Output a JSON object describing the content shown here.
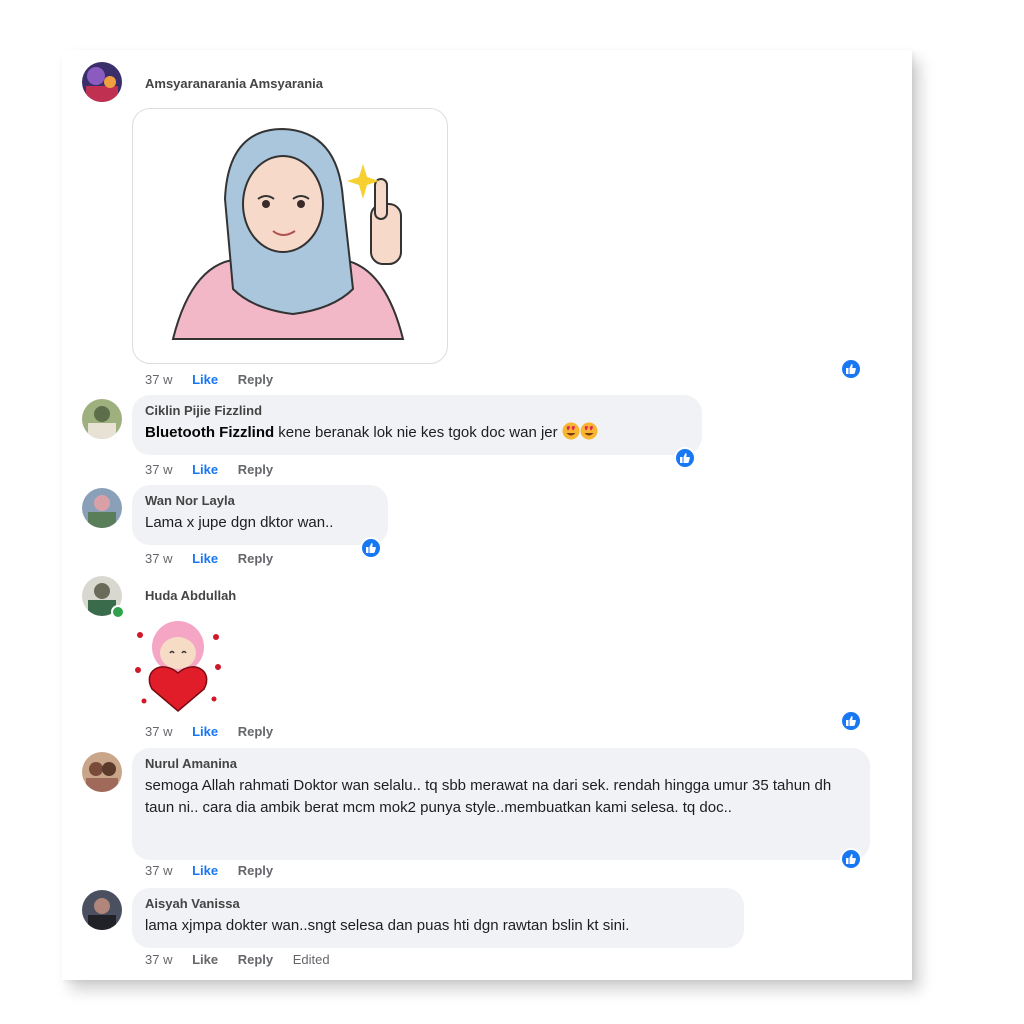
{
  "meta": {
    "age": "37 w",
    "like": "Like",
    "reply": "Reply",
    "edited": "Edited"
  },
  "comments": [
    {
      "author": "Amsyaranarania Amsyarania"
    },
    {
      "author": "Ciklin Pijie Fizzlind",
      "tag": "Bluetooth Fizzlind",
      "text": " kene beranak lok nie kes tgok doc wan jer"
    },
    {
      "author": "Wan Nor Layla",
      "text": "Lama x jupe dgn dktor wan.."
    },
    {
      "author": "Huda Abdullah"
    },
    {
      "author": "Nurul Amanina",
      "text": "semoga Allah rahmati Doktor wan selalu.. tq sbb merawat na dari sek. rendah hingga umur 35 tahun dh taun ni.. cara dia ambik berat mcm mok2 punya style..membuatkan kami selesa. tq doc.."
    },
    {
      "author": "Aisyah Vanissa",
      "text": "lama xjmpa dokter wan..sngt selesa dan puas hti dgn rawtan bslin kt sini."
    }
  ],
  "icons": {
    "reaction": "like-reaction-icon",
    "emoji": "heart-eyes-emoji-icon"
  },
  "colors": {
    "like_blue": "#1877f2",
    "bubble": "#f0f2f5",
    "online": "#31a24c"
  }
}
